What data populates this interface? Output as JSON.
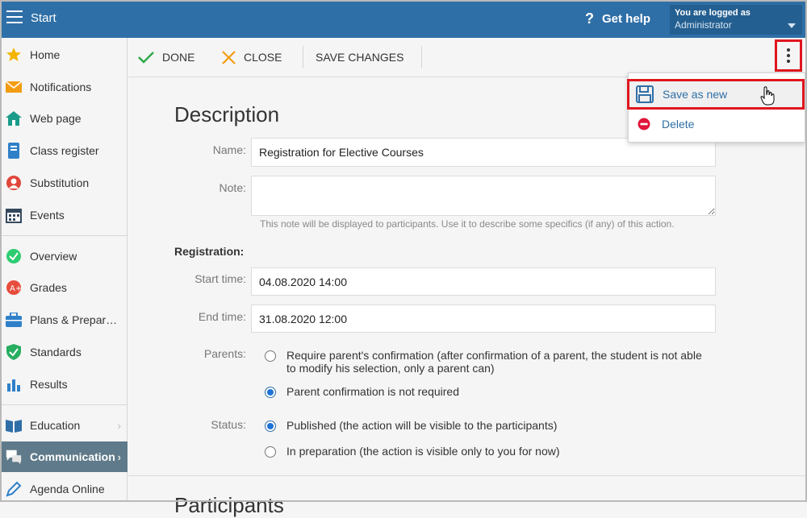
{
  "topbar": {
    "title": "Start",
    "help_label": "Get help",
    "help_icon": "?",
    "login_line1": "You are logged as",
    "login_line2": "Administrator"
  },
  "sidebar": {
    "items": [
      {
        "label": "Home",
        "icon": "star-icon"
      },
      {
        "label": "Notifications",
        "icon": "envelope-icon"
      },
      {
        "label": "Web page",
        "icon": "house-icon"
      },
      {
        "label": "Class register",
        "icon": "book-icon"
      },
      {
        "label": "Substitution",
        "icon": "person-icon"
      },
      {
        "label": "Events",
        "icon": "calendar-icon"
      },
      {
        "label": "Overview",
        "icon": "check-circle-icon"
      },
      {
        "label": "Grades",
        "icon": "grade-icon"
      },
      {
        "label": "Plans & Prepar…",
        "icon": "briefcase-icon"
      },
      {
        "label": "Standards",
        "icon": "shield-icon"
      },
      {
        "label": "Results",
        "icon": "bar-chart-icon"
      },
      {
        "label": "Education",
        "icon": "open-book-icon"
      },
      {
        "label": "Communication",
        "icon": "chat-icon"
      },
      {
        "label": "Agenda Online",
        "icon": "pencil-icon"
      }
    ]
  },
  "toolbar": {
    "done_label": "DONE",
    "close_label": "CLOSE",
    "save_label": "SAVE CHANGES"
  },
  "menu": {
    "save_as_new": "Save as new",
    "delete": "Delete"
  },
  "form": {
    "heading": "Description",
    "name_label": "Name:",
    "name_value": "Registration for Elective Courses",
    "note_label": "Note:",
    "note_value": "",
    "note_hint": "This note will be displayed to participants. Use it to describe some specifics (if any) of this action.",
    "registration_heading": "Registration:",
    "start_label": "Start time:",
    "start_value": "04.08.2020 14:00",
    "end_label": "End time:",
    "end_value": "31.08.2020 12:00",
    "parents_label": "Parents:",
    "parents_opt1": "Require parent's confirmation (after confirmation of a parent, the student is not able to modify his selection, only a parent can)",
    "parents_opt2": "Parent confirmation is not required",
    "status_label": "Status:",
    "status_opt1": "Published (the action will be visible to the participants)",
    "status_opt2": "In preparation (the action is visible only to you for now)",
    "next_heading": "Participants"
  },
  "colors": {
    "topbar": "#2f6fa7",
    "active_sidebar": "#5f7a8a",
    "highlight_red": "#e0161e",
    "link_blue": "#2f6fa7"
  }
}
